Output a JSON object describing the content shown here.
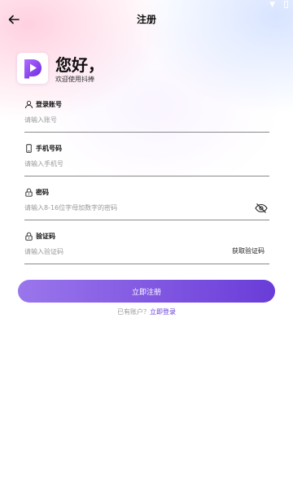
{
  "header": {
    "title": "注册"
  },
  "brand": {
    "greeting": "您好，",
    "welcome": "欢迎使用抖捧"
  },
  "form": {
    "account": {
      "label": "登录账号",
      "placeholder": "请输入账号",
      "value": ""
    },
    "phone": {
      "label": "手机号码",
      "placeholder": "请输入手机号",
      "value": ""
    },
    "password": {
      "label": "密码",
      "placeholder": "请输入8-16位字母加数字的密码",
      "value": ""
    },
    "code": {
      "label": "验证码",
      "placeholder": "请输入验证码",
      "value": "",
      "get_code_label": "获取验证码"
    }
  },
  "actions": {
    "register_label": "立即注册",
    "login_prompt": "已有账户？",
    "login_link": "立即登录"
  },
  "icons": {
    "back": "arrow-left-icon",
    "logo": "app-logo-icon",
    "account": "user-icon",
    "phone": "phone-icon",
    "password": "lock-icon",
    "code": "lock-icon",
    "eye": "eye-off-icon"
  },
  "colors": {
    "accent_start": "#9a76ec",
    "accent_end": "#6a3cd8",
    "link": "#6a3cd8",
    "underline": "#8a8a8a"
  }
}
